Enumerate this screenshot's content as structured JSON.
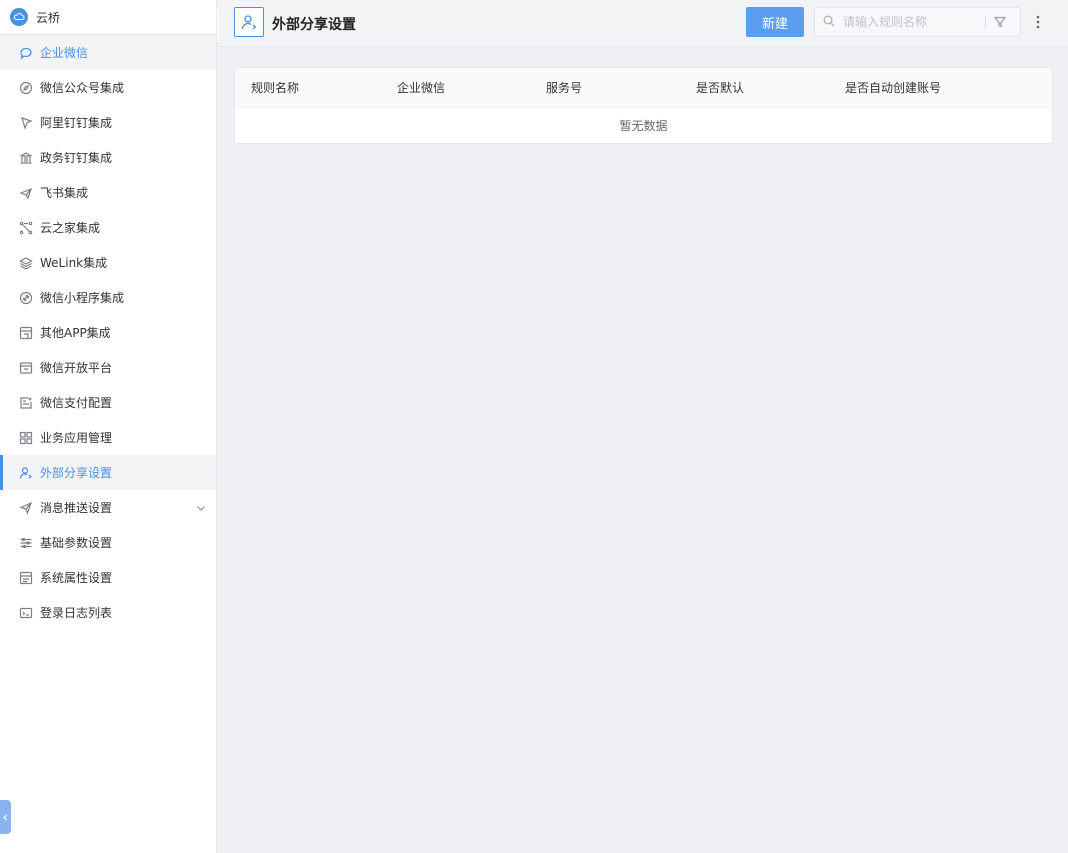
{
  "app": {
    "name": "云桥"
  },
  "sidebar": {
    "top_item": {
      "label": "企业微信",
      "icon": "chat-bubble-icon"
    },
    "items": [
      {
        "label": "微信公众号集成",
        "icon": "compass-icon"
      },
      {
        "label": "阿里钉钉集成",
        "icon": "pin-icon"
      },
      {
        "label": "政务钉钉集成",
        "icon": "bank-icon"
      },
      {
        "label": "飞书集成",
        "icon": "paper-plane-icon"
      },
      {
        "label": "云之家集成",
        "icon": "nodes-icon"
      },
      {
        "label": "WeLink集成",
        "icon": "layers-icon"
      },
      {
        "label": "微信小程序集成",
        "icon": "link-circle-icon"
      },
      {
        "label": "其他APP集成",
        "icon": "app-panel-icon"
      },
      {
        "label": "微信开放平台",
        "icon": "window-icon"
      },
      {
        "label": "微信支付配置",
        "icon": "list-card-icon"
      },
      {
        "label": "业务应用管理",
        "icon": "grid-icon"
      },
      {
        "label": "外部分享设置",
        "icon": "user-share-icon",
        "active": true
      },
      {
        "label": "消息推送设置",
        "icon": "send-icon",
        "expandable": true
      },
      {
        "label": "基础参数设置",
        "icon": "sliders-icon"
      },
      {
        "label": "系统属性设置",
        "icon": "form-icon"
      },
      {
        "label": "登录日志列表",
        "icon": "log-icon"
      }
    ]
  },
  "header": {
    "title": "外部分享设置",
    "new_label": "新建",
    "search_placeholder": "请输入规则名称"
  },
  "table": {
    "columns": [
      "规则名称",
      "企业微信",
      "服务号",
      "是否默认",
      "是否自动创建账号"
    ],
    "rows": [],
    "empty_text": "暂无数据"
  },
  "colors": {
    "accent": "#4a90e2",
    "button": "#5b9ef0",
    "background": "#eef0f4"
  }
}
